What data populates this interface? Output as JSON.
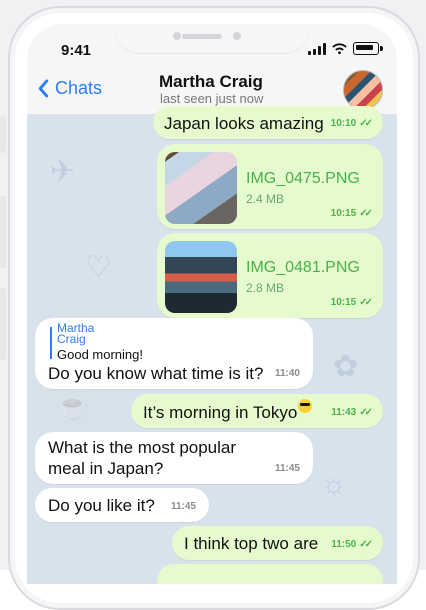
{
  "status": {
    "time": "9:41"
  },
  "header": {
    "back_label": "Chats",
    "contact_name": "Martha Craig",
    "last_seen": "last seen just now"
  },
  "messages": [
    {
      "text": "Japan looks amazing!",
      "time": "10:10"
    },
    {
      "file_name": "IMG_0475.PNG",
      "file_size": "2.4 MB",
      "time": "10:15"
    },
    {
      "file_name": "IMG_0481.PNG",
      "file_size": "2.8 MB",
      "time": "10:15"
    },
    {
      "reply_name": "Martha Craig",
      "reply_text": "Good morning!",
      "text": "Do you know what time is it?",
      "time": "11:40"
    },
    {
      "text": "It’s morning in Tokyo",
      "time": "11:43"
    },
    {
      "text": "What is the most popular meal in Japan?",
      "time": "11:45"
    },
    {
      "text": "Do you like it?",
      "time": "11:45"
    },
    {
      "text": "I think top two are",
      "time": "11:50"
    }
  ],
  "colors": {
    "accent": "#2f7cf6",
    "outgoing": "#e5fbcd",
    "incoming": "#ffffff",
    "chat_background": "#d7e2ec"
  }
}
